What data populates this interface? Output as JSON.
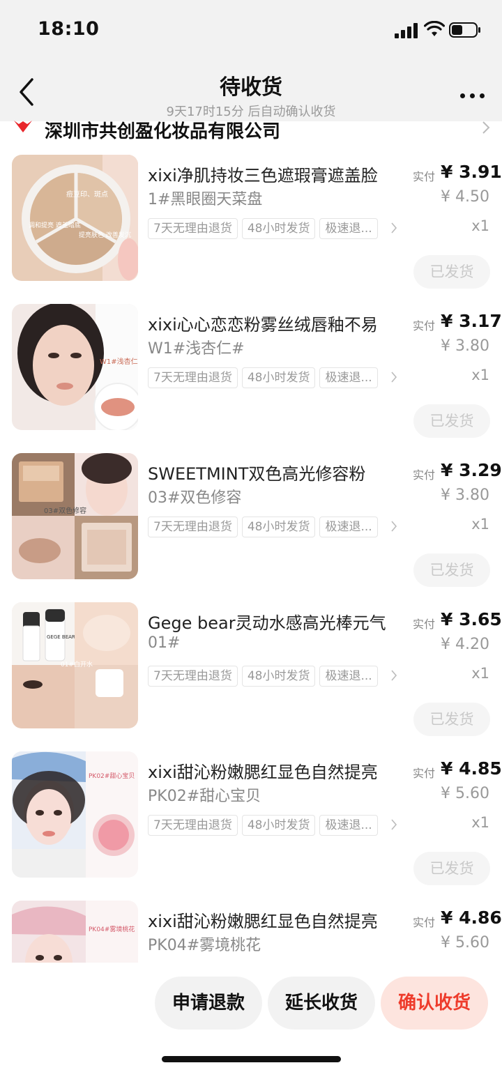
{
  "status_bar": {
    "time": "18:10"
  },
  "header": {
    "title": "待收货",
    "subtitle": "9天17时15分 后自动确认收货"
  },
  "store": {
    "name": "深圳市共创盈化妆品有限公司"
  },
  "colors": {
    "accent": "#ee3b2b",
    "confirm_bg": "#fde4de",
    "page_bg": "#f2f2f2"
  },
  "products": [
    {
      "title": "xixi净肌持妆三色遮瑕膏遮盖脸",
      "variant": "1#黑眼圈天菜盘",
      "tags": [
        "7天无理由退货",
        "48小时发货",
        "极速退..."
      ],
      "paid_label": "实付",
      "paid_price": "¥ 3.91",
      "original_price": "¥ 4.50",
      "quantity": "x1",
      "status": "已发货",
      "image_text": [
        "痘豆印、斑点",
        "提亮肤色 改善发沉",
        "调和提亮 遮盖暗底"
      ]
    },
    {
      "title": "xixi心心恋恋粉雾丝绒唇釉不易",
      "variant": "W1#浅杏仁#",
      "tags": [
        "7天无理由退货",
        "48小时发货",
        "极速退..."
      ],
      "paid_label": "实付",
      "paid_price": "¥ 3.17",
      "original_price": "¥ 3.80",
      "quantity": "x1",
      "status": "已发货",
      "image_text": [
        "W1#浅杏仁"
      ]
    },
    {
      "title": "SWEETMINT双色高光修容粉",
      "variant": "03#双色修容",
      "tags": [
        "7天无理由退货",
        "48小时发货",
        "极速退..."
      ],
      "paid_label": "实付",
      "paid_price": "¥ 3.29",
      "original_price": "¥ 3.80",
      "quantity": "x1",
      "status": "已发货",
      "image_text": [
        "03#双色修容"
      ]
    },
    {
      "title": "Gege bear灵动水感高光棒元气",
      "variant": "01#",
      "tags": [
        "7天无理由退货",
        "48小时发货",
        "极速退..."
      ],
      "paid_label": "实付",
      "paid_price": "¥ 3.65",
      "original_price": "¥ 4.20",
      "quantity": "x1",
      "status": "已发货",
      "image_text": [
        "01#白开水",
        "GEGE BEAR"
      ]
    },
    {
      "title": "xixi甜沁粉嫩腮红显色自然提亮",
      "variant": "PK02#甜心宝贝",
      "tags": [
        "7天无理由退货",
        "48小时发货",
        "极速退..."
      ],
      "paid_label": "实付",
      "paid_price": "¥ 4.85",
      "original_price": "¥ 5.60",
      "quantity": "x1",
      "status": "已发货",
      "image_text": [
        "PK02#甜心宝贝"
      ]
    },
    {
      "title": "xixi甜沁粉嫩腮红显色自然提亮",
      "variant": "PK04#雾境桃花",
      "tags": [],
      "paid_label": "实付",
      "paid_price": "¥ 4.86",
      "original_price": "¥ 5.60",
      "quantity": "",
      "status": "",
      "image_text": [
        "PK04#雾境桃花"
      ]
    }
  ],
  "actions": {
    "refund_label": "申请退款",
    "extend_label": "延长收货",
    "confirm_label": "确认收货"
  }
}
